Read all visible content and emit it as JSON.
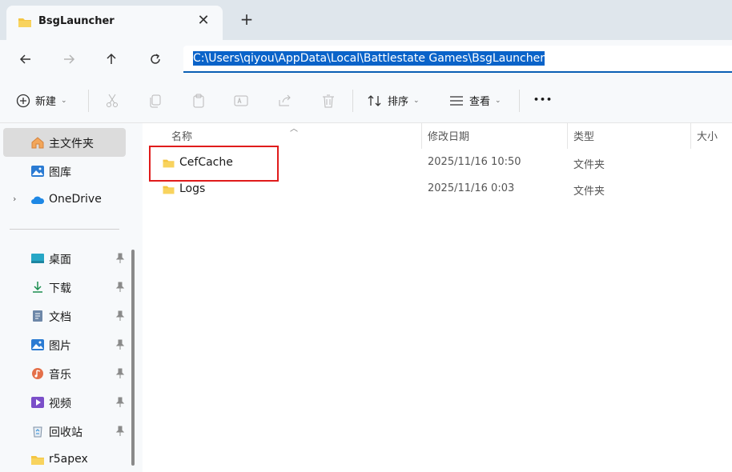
{
  "tab": {
    "title": "BsgLauncher",
    "close_glyph": "✕",
    "new_tab_glyph": "+"
  },
  "nav": {
    "back_icon": "arrow-left-icon",
    "forward_icon": "arrow-right-icon",
    "up_icon": "arrow-up-icon",
    "refresh_icon": "refresh-icon",
    "address": "C:\\Users\\qiyou\\AppData\\Local\\Battlestate Games\\BsgLauncher"
  },
  "toolbar": {
    "new_label": "新建",
    "sort_label": "排序",
    "view_label": "查看",
    "more_glyph": "•••"
  },
  "sidebar": {
    "home": "主文件夹",
    "gallery": "图库",
    "onedrive": "OneDrive",
    "pinned": [
      {
        "label": "桌面",
        "icon": "desktop-icon"
      },
      {
        "label": "下载",
        "icon": "download-icon"
      },
      {
        "label": "文档",
        "icon": "document-icon"
      },
      {
        "label": "图片",
        "icon": "pictures-icon"
      },
      {
        "label": "音乐",
        "icon": "music-icon"
      },
      {
        "label": "视频",
        "icon": "video-icon"
      },
      {
        "label": "回收站",
        "icon": "recycle-bin-icon"
      },
      {
        "label": "r5apex",
        "icon": "folder-icon"
      }
    ]
  },
  "columns": {
    "name": "名称",
    "modified": "修改日期",
    "type": "类型",
    "size": "大小"
  },
  "files": [
    {
      "name": "CefCache",
      "modified": "2025/11/16 10:50",
      "type": "文件夹"
    },
    {
      "name": "Logs",
      "modified": "2025/11/16 0:03",
      "type": "文件夹"
    }
  ],
  "colors": {
    "accent": "#0a63c9",
    "folder": "#f4c542",
    "highlight": "#e01b1b"
  }
}
